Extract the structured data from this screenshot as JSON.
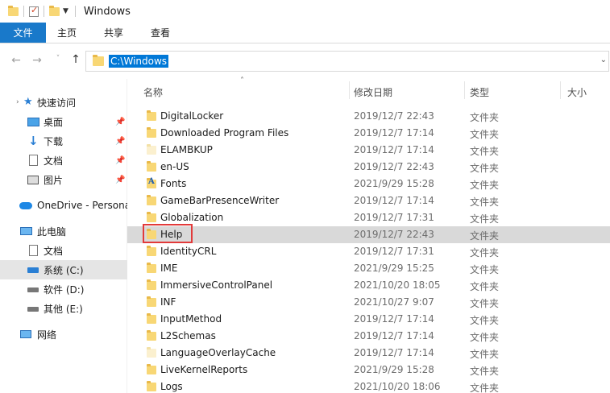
{
  "title": "Windows",
  "ribbon": {
    "tabs": [
      "文件",
      "主页",
      "共享",
      "查看"
    ]
  },
  "address": {
    "path": "C:\\Windows"
  },
  "nav": {
    "items": [
      {
        "label": "快速访问",
        "icon": "star-icon"
      },
      {
        "label": "桌面",
        "icon": "desktop-icon",
        "pinned": true
      },
      {
        "label": "下载",
        "icon": "download-icon",
        "pinned": true
      },
      {
        "label": "文档",
        "icon": "document-icon",
        "pinned": true
      },
      {
        "label": "图片",
        "icon": "picture-icon",
        "pinned": true
      },
      {
        "label": "OneDrive - Persona",
        "icon": "cloud-icon"
      },
      {
        "label": "此电脑",
        "icon": "computer-icon"
      },
      {
        "label": "文档",
        "icon": "document-icon"
      },
      {
        "label": "系统 (C:)",
        "icon": "drive-c-icon",
        "selected": true
      },
      {
        "label": "软件 (D:)",
        "icon": "drive-icon"
      },
      {
        "label": "其他 (E:)",
        "icon": "drive-icon"
      },
      {
        "label": "网络",
        "icon": "network-icon"
      }
    ]
  },
  "columns": {
    "name": "名称",
    "date": "修改日期",
    "type": "类型",
    "size": "大小"
  },
  "files": [
    {
      "name": "DigitalLocker",
      "date": "2019/12/7 22:43",
      "type": "文件夹",
      "icon": "folder-icon"
    },
    {
      "name": "Downloaded Program Files",
      "date": "2019/12/7 17:14",
      "type": "文件夹",
      "icon": "folder-icon"
    },
    {
      "name": "ELAMBKUP",
      "date": "2019/12/7 17:14",
      "type": "文件夹",
      "icon": "folder-hidden-icon"
    },
    {
      "name": "en-US",
      "date": "2019/12/7 22:43",
      "type": "文件夹",
      "icon": "folder-icon"
    },
    {
      "name": "Fonts",
      "date": "2021/9/29 15:28",
      "type": "文件夹",
      "icon": "fonts-folder-icon"
    },
    {
      "name": "GameBarPresenceWriter",
      "date": "2019/12/7 17:14",
      "type": "文件夹",
      "icon": "folder-icon"
    },
    {
      "name": "Globalization",
      "date": "2019/12/7 17:31",
      "type": "文件夹",
      "icon": "folder-icon"
    },
    {
      "name": "Help",
      "date": "2019/12/7 22:43",
      "type": "文件夹",
      "icon": "folder-icon",
      "selected": true
    },
    {
      "name": "IdentityCRL",
      "date": "2019/12/7 17:31",
      "type": "文件夹",
      "icon": "folder-icon"
    },
    {
      "name": "IME",
      "date": "2021/9/29 15:25",
      "type": "文件夹",
      "icon": "folder-icon"
    },
    {
      "name": "ImmersiveControlPanel",
      "date": "2021/10/20 18:05",
      "type": "文件夹",
      "icon": "folder-icon"
    },
    {
      "name": "INF",
      "date": "2021/10/27 9:07",
      "type": "文件夹",
      "icon": "folder-icon"
    },
    {
      "name": "InputMethod",
      "date": "2019/12/7 17:14",
      "type": "文件夹",
      "icon": "folder-icon"
    },
    {
      "name": "L2Schemas",
      "date": "2019/12/7 17:14",
      "type": "文件夹",
      "icon": "folder-icon"
    },
    {
      "name": "LanguageOverlayCache",
      "date": "2019/12/7 17:14",
      "type": "文件夹",
      "icon": "folder-hidden-icon"
    },
    {
      "name": "LiveKernelReports",
      "date": "2021/9/29 15:28",
      "type": "文件夹",
      "icon": "folder-icon"
    },
    {
      "name": "Logs",
      "date": "2021/10/20 18:06",
      "type": "文件夹",
      "icon": "folder-icon"
    }
  ]
}
